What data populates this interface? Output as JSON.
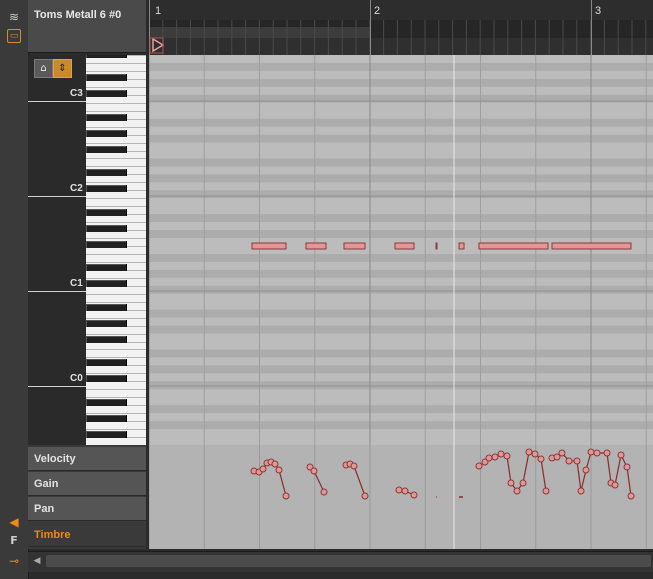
{
  "clip": {
    "title": "Toms Metall 6 #0"
  },
  "ruler": {
    "bars": [
      "1",
      "2",
      "3"
    ]
  },
  "piano": {
    "octaves": [
      "C3",
      "C2",
      "C1",
      "C0"
    ]
  },
  "lanes": [
    {
      "label": "Velocity",
      "active": false
    },
    {
      "label": "Gain",
      "active": false
    },
    {
      "label": "Pan",
      "active": false
    },
    {
      "label": "Timbre",
      "active": true
    }
  ],
  "colors": {
    "note_fill": "#e29696",
    "note_border": "#8a3a3a",
    "accent": "#ec8a1a",
    "grid_bg": "#b9b9b9"
  },
  "icons": {
    "left_strip": [
      "layers-icon",
      "clip-icon",
      "speaker-icon",
      "f-icon",
      "key-icon"
    ],
    "tool_a": "pointer-tool-icon",
    "tool_b": "zoom-tool-icon"
  }
}
